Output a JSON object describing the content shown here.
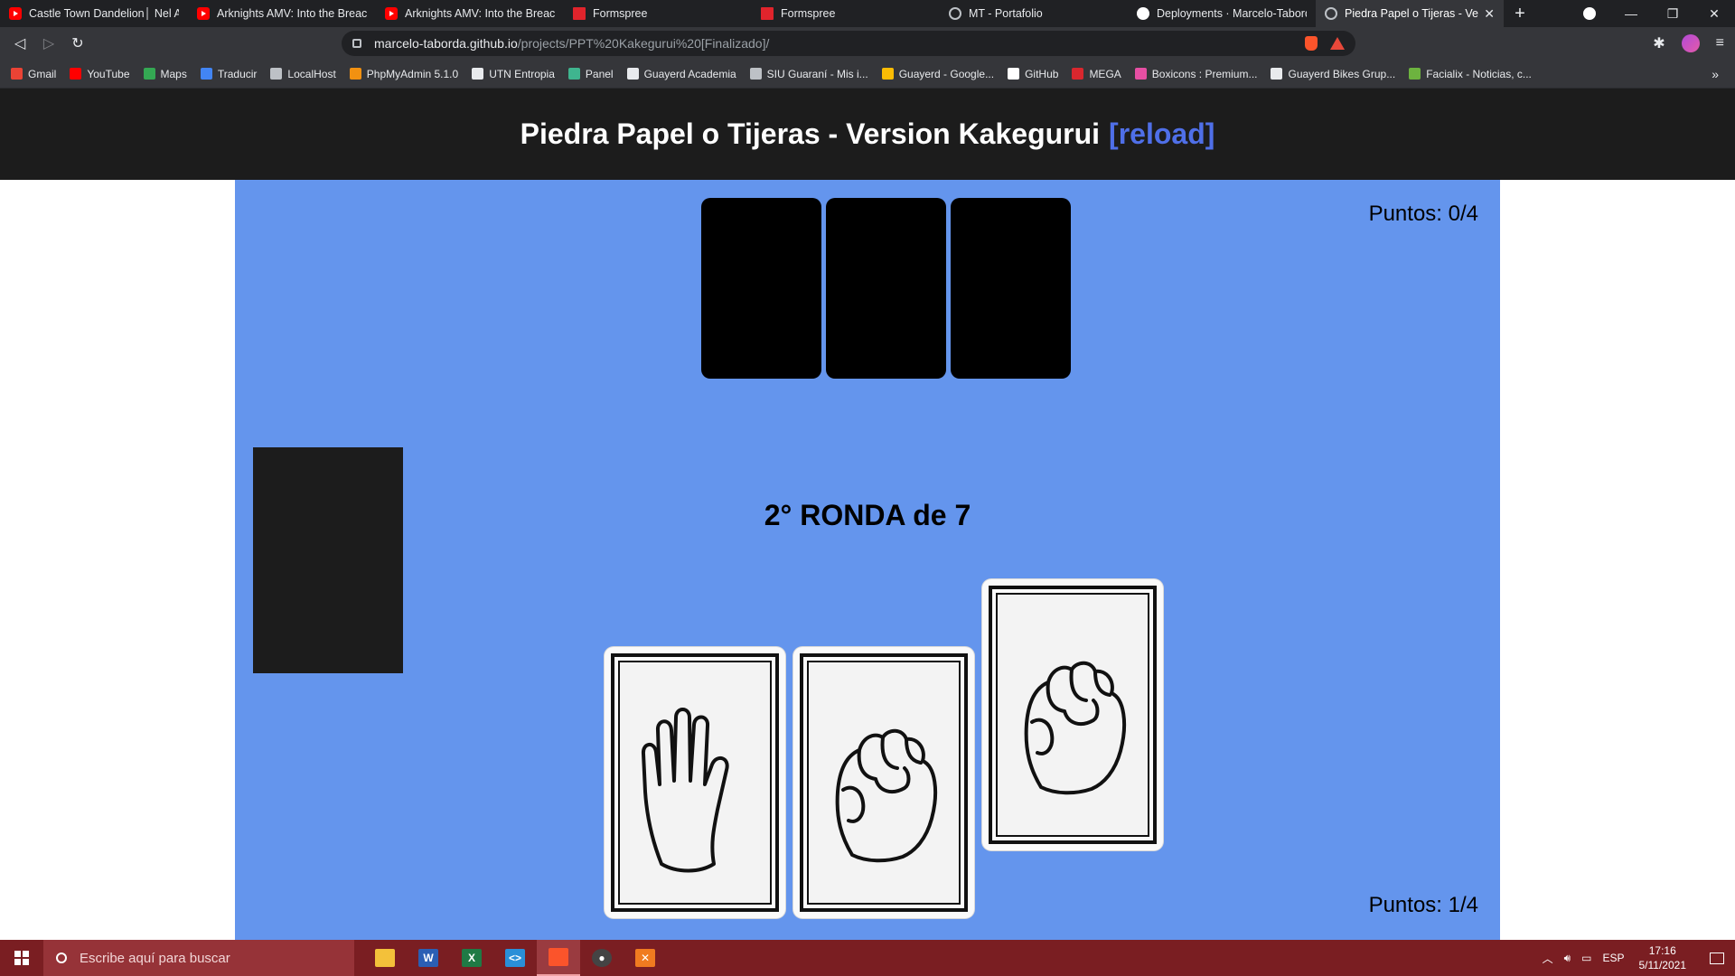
{
  "browser": {
    "tabs": [
      {
        "title": "Castle Town Dandelion│ Nel A M",
        "icon": "youtube-icon",
        "active": false
      },
      {
        "title": "Arknights AMV: Into the Breach",
        "icon": "youtube-icon",
        "active": false
      },
      {
        "title": "Arknights AMV: Into the Breach",
        "icon": "youtube-icon",
        "active": false
      },
      {
        "title": "Formspree",
        "icon": "formspree-icon",
        "active": false
      },
      {
        "title": "Formspree",
        "icon": "formspree-icon",
        "active": false
      },
      {
        "title": "MT - Portafolio",
        "icon": "globe-icon",
        "active": false
      },
      {
        "title": "Deployments · Marcelo-Taborda",
        "icon": "github-icon",
        "active": false
      },
      {
        "title": "Piedra Papel o Tijeras - Version Kakegurui",
        "icon": "globe-icon",
        "active": true
      }
    ],
    "url_host": "marcelo-taborda.github.io",
    "url_path": "/projects/PPT%20Kakegurui%20[Finalizado]/",
    "bookmarks": [
      {
        "label": "Gmail",
        "color": "#ea4335"
      },
      {
        "label": "YouTube",
        "color": "#ff0000"
      },
      {
        "label": "Maps",
        "color": "#34a853"
      },
      {
        "label": "Traducir",
        "color": "#4285f4"
      },
      {
        "label": "LocalHost",
        "color": "#bdc1c6"
      },
      {
        "label": "PhpMyAdmin 5.1.0",
        "color": "#f29111"
      },
      {
        "label": "UTN Entropia",
        "color": "#e8eaed"
      },
      {
        "label": "Panel",
        "color": "#3fb58f"
      },
      {
        "label": "Guayerd Academia",
        "color": "#e8eaed"
      },
      {
        "label": "SIU Guaraní - Mis i...",
        "color": "#bdc1c6"
      },
      {
        "label": "Guayerd - Google...",
        "color": "#fbbc04"
      },
      {
        "label": "GitHub",
        "color": "#ffffff"
      },
      {
        "label": "MEGA",
        "color": "#d9272e"
      },
      {
        "label": "Boxicons : Premium...",
        "color": "#e64fa3"
      },
      {
        "label": "Guayerd Bikes Grup...",
        "color": "#e8eaed"
      },
      {
        "label": "Facialix - Noticias, c...",
        "color": "#6db33f"
      }
    ],
    "bookmarks_more": "»"
  },
  "page": {
    "title": "Piedra Papel o Tijeras - Version Kakegurui",
    "reload_label": "[reload]",
    "score_top": "Puntos: 0/4",
    "score_bottom": "Puntos: 1/4",
    "round_label": "2° RONDA de 7",
    "opponent_cards_count": 3,
    "player_cards": [
      {
        "name": "paper",
        "icon": "open-hand-icon"
      },
      {
        "name": "rock",
        "icon": "fist-icon"
      },
      {
        "name": "rock",
        "icon": "fist-icon"
      }
    ],
    "colors": {
      "header_bg": "#1c1c1c",
      "game_bg": "#6495ed",
      "reload_link": "#4f6fe8",
      "card_back": "#000000",
      "deck": "#1c1c1c"
    }
  },
  "taskbar": {
    "search_placeholder": "Escribe aquí para buscar",
    "language": "ESP",
    "time": "17:16",
    "date": "5/11/2021",
    "color": "#7a1e22"
  }
}
